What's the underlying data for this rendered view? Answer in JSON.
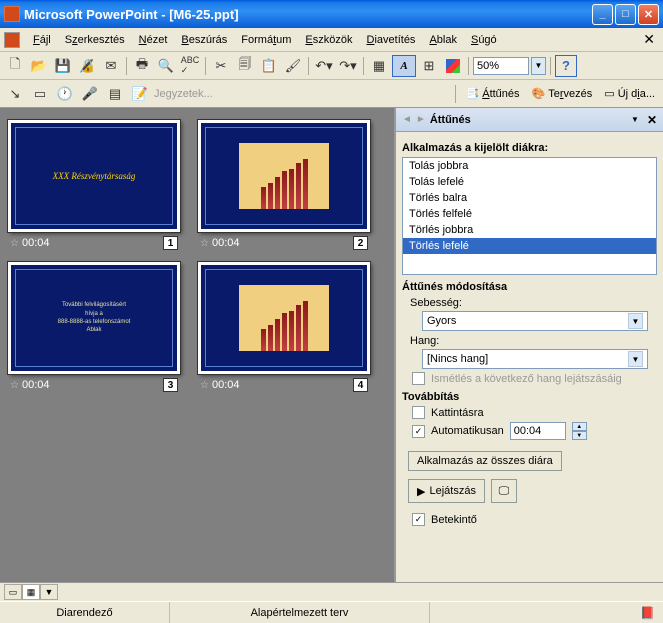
{
  "titlebar": {
    "app": "Microsoft PowerPoint",
    "doc": "[M6-25.ppt]"
  },
  "menu": {
    "file": "Fájl",
    "edit": "Szerkesztés",
    "view": "Nézet",
    "insert": "Beszúrás",
    "format": "Formátum",
    "tools": "Eszközök",
    "slideshow": "Diavetítés",
    "window": "Ablak",
    "help": "Súgó"
  },
  "toolbar": {
    "zoom": "50%",
    "notes_label": "Jegyzetek...",
    "attunes": "Áttűnés",
    "tervezes": "Tervezés",
    "ujdia": "Új dia..."
  },
  "slides": [
    {
      "time": "00:04",
      "num": "1",
      "title": "XXX Részvénytársaság"
    },
    {
      "time": "00:04",
      "num": "2"
    },
    {
      "time": "00:04",
      "num": "3",
      "text1": "További felvilágosításért",
      "text2": "hívja a",
      "text3": "888-8888-as telefonszámot",
      "text4": "Ablak"
    },
    {
      "time": "00:04",
      "num": "4"
    }
  ],
  "taskpane": {
    "title": "Áttűnés",
    "section1": "Alkalmazás a kijelölt diákra:",
    "transitions": [
      {
        "label": "Tolás jobbra",
        "selected": false
      },
      {
        "label": "Tolás lefelé",
        "selected": false
      },
      {
        "label": "Törlés balra",
        "selected": false
      },
      {
        "label": "Törlés felfelé",
        "selected": false
      },
      {
        "label": "Törlés jobbra",
        "selected": false
      },
      {
        "label": "Törlés lefelé",
        "selected": true
      }
    ],
    "section2": "Áttűnés módosítása",
    "speed_label": "Sebesség:",
    "speed_value": "Gyors",
    "sound_label": "Hang:",
    "sound_value": "[Nincs hang]",
    "loop_label": "Ismétlés a következő hang lejátszásáig",
    "section3": "Továbbítás",
    "onclick_label": "Kattintásra",
    "auto_label": "Automatikusan",
    "auto_time": "00:04",
    "apply_all": "Alkalmazás az összes diára",
    "play": "Lejátszás",
    "autopreview": "Betekintő"
  },
  "statusbar": {
    "view": "Diarendező",
    "design": "Alapértelmezett terv"
  }
}
